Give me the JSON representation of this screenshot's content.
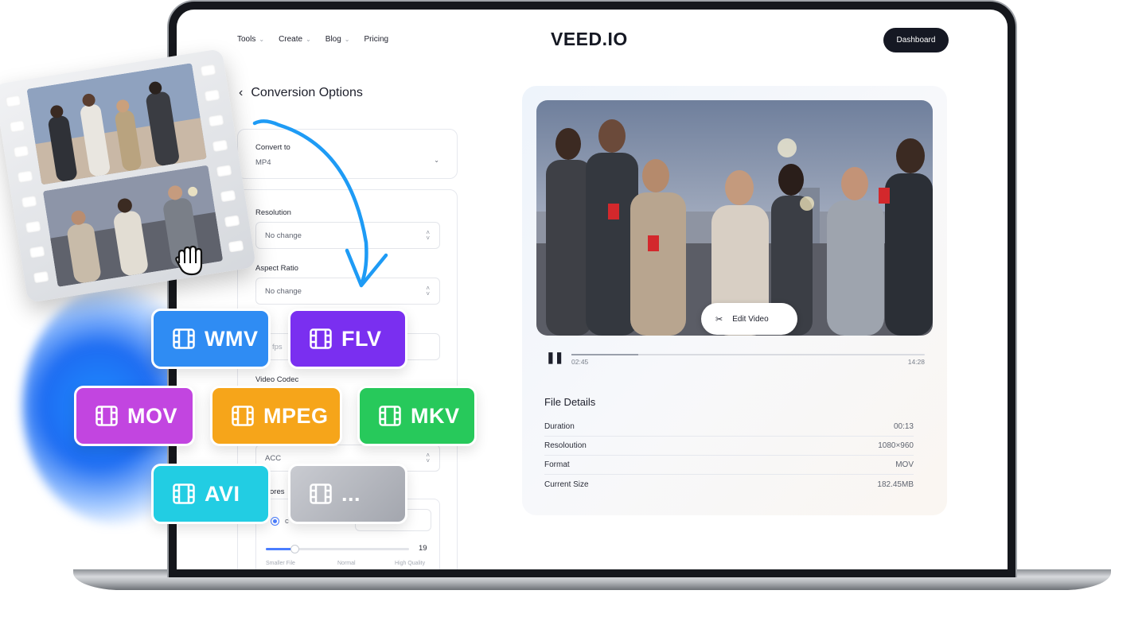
{
  "nav": {
    "items": [
      {
        "label": "Tools",
        "has_caret": true
      },
      {
        "label": "Create",
        "has_caret": true
      },
      {
        "label": "Blog",
        "has_caret": true
      },
      {
        "label": "Pricing",
        "has_caret": false
      }
    ],
    "logo": "VEED.IO",
    "dashboard_label": "Dashboard"
  },
  "options": {
    "title": "Conversion Options",
    "convert_to": {
      "label": "Convert to",
      "value": "MP4"
    },
    "resolution": {
      "label": "Resolution",
      "value": "No change"
    },
    "aspect_ratio": {
      "label": "Aspect Ratio",
      "value": "No change"
    },
    "frame_rate_fragment": "fps",
    "video_codec": {
      "label": "Video Codec"
    },
    "audio_codec_value": "ACC",
    "compression_fragment": "ores",
    "radio_fragment": "c",
    "slider": {
      "value": "19",
      "level": 0.2,
      "labels": [
        "Smaller File",
        "Normal",
        "High Quality"
      ]
    }
  },
  "preview": {
    "edit_label": "Edit Video",
    "current_time": "02:45",
    "total_time": "14:28",
    "progress": 0.19
  },
  "file_details": {
    "title": "File Details",
    "rows": [
      {
        "label": "Duration",
        "value": "00:13"
      },
      {
        "label": "Resoloution",
        "value": "1080×960"
      },
      {
        "label": "Format",
        "value": "MOV"
      },
      {
        "label": "Current Size",
        "value": "182.45MB"
      }
    ]
  },
  "formats": [
    {
      "label": "WMV",
      "color": "#2f8cf3"
    },
    {
      "label": "FLV",
      "color": "#7a2ff0"
    },
    {
      "label": "MOV",
      "color": "#c245e0"
    },
    {
      "label": "MPEG",
      "color": "#f6a51a"
    },
    {
      "label": "MKV",
      "color": "#27c95b"
    },
    {
      "label": "AVI",
      "color": "#22cde3"
    },
    {
      "label": "...",
      "color": "#a9abb3"
    }
  ],
  "colors": {
    "accent": "#4a7dff",
    "dark": "#151823",
    "arrow": "#1e9bf5"
  }
}
